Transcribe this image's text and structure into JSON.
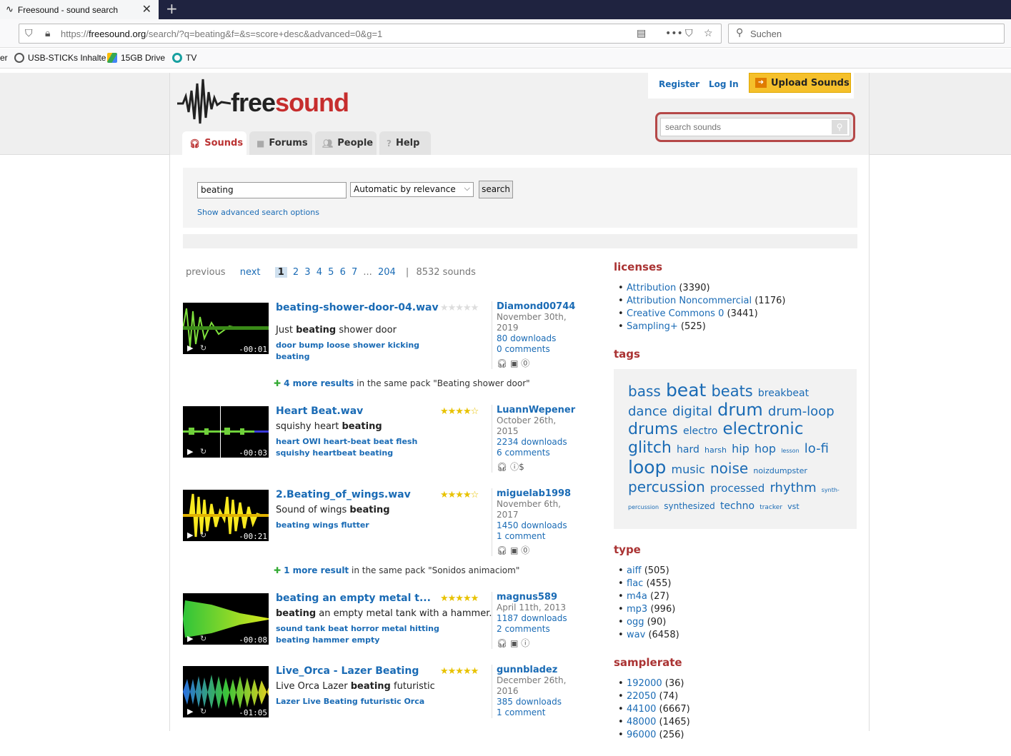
{
  "browser": {
    "tab_title": "Freesound - sound search",
    "url_prefix": "https://",
    "url_domain": "freesound.org",
    "url_rest": "/search/?q=beating&f=&s=score+desc&advanced=0&g=1",
    "search_placeholder": "Suchen",
    "bookmarks": [
      "er",
      "USB-STICKs Inhalte",
      "15GB Drive",
      "TV"
    ]
  },
  "header": {
    "logo_part1": "free",
    "logo_part2": "sound",
    "register": "Register",
    "login": "Log In",
    "upload": "Upload Sounds",
    "search_placeholder": "search sounds",
    "tabs": [
      "Sounds",
      "Forums",
      "People",
      "Help"
    ]
  },
  "search": {
    "query": "beating",
    "sort": "Automatic by relevance",
    "button": "search",
    "advanced": "Show advanced search options"
  },
  "pager": {
    "previous": "previous",
    "next": "next",
    "pages": [
      "1",
      "2",
      "3",
      "4",
      "5",
      "6",
      "7"
    ],
    "ellipsis": "...",
    "last": "204",
    "sep": "|",
    "count": "8532 sounds"
  },
  "results": [
    {
      "title": "beating-shower-door-04.wav",
      "desc_pre": "Just ",
      "desc_bold": "beating",
      "desc_post": " shower door",
      "tags": "door bump loose shower kicking beating",
      "duration": "-00:01",
      "stars": "★★★★★",
      "user": "Diamond00744",
      "date": "November 30th, 2019",
      "downloads": "80 downloads",
      "comments": "0 comments",
      "colors": [
        "#7ee03c",
        "#3a8a18"
      ]
    },
    {
      "title": "Heart Beat.wav",
      "desc_pre": "squishy heart ",
      "desc_bold": "beating",
      "desc_post": "",
      "tags": "heart OWI heart-beat beat flesh squishy heartbeat beating",
      "duration": "-00:03",
      "stars": "★★★★☆",
      "user": "LuannWepener",
      "date": "October 26th, 2015",
      "downloads": "2234 downloads",
      "comments": "6 comments",
      "colors": [
        "#6fd13a",
        "#3a3adb"
      ]
    },
    {
      "title": "2.Beating_of_wings.wav",
      "desc_pre": "Sound of wings ",
      "desc_bold": "beating",
      "desc_post": "",
      "tags": "beating wings flutter",
      "duration": "-00:21",
      "stars": "★★★★☆",
      "user": "miguelab1998",
      "date": "November 6th, 2017",
      "downloads": "1450 downloads",
      "comments": "1 comment",
      "colors": [
        "#f7e81f",
        "#e0b200"
      ]
    },
    {
      "title": "beating an empty metal t...",
      "desc_pre": "",
      "desc_bold": "beating",
      "desc_post": " an empty metal tank with a hammer.",
      "tags": "sound tank beat horror metal hitting beating hammer empty",
      "duration": "-00:08",
      "stars": "★★★★★",
      "user": "magnus589",
      "date": "April 11th, 2013",
      "downloads": "1187 downloads",
      "comments": "2 comments",
      "colors": [
        "#2fc43a",
        "#d8e81a"
      ]
    },
    {
      "title": "Live_Orca - Lazer Beating",
      "desc_pre": "Live Orca Lazer ",
      "desc_bold": "beating",
      "desc_post": " futuristic",
      "tags": "Lazer Live Beating futuristic Orca",
      "duration": "-01:05",
      "stars": "★★★★★",
      "user": "gunnbladez",
      "date": "December 26th, 2016",
      "downloads": "385 downloads",
      "comments": "1 comment",
      "colors": [
        "#2a6fe0",
        "#e0d020"
      ]
    }
  ],
  "more_results": [
    {
      "count": "4 more results",
      "text": " in the same pack \"Beating shower door\""
    },
    {
      "count": "1 more result",
      "text": " in the same pack \"Sonidos animaciom\""
    }
  ],
  "sidebar": {
    "licenses_title": "licenses",
    "licenses": [
      {
        "name": "Attribution",
        "count": "(3390)"
      },
      {
        "name": "Attribution Noncommercial",
        "count": "(1176)"
      },
      {
        "name": "Creative Commons 0",
        "count": "(3441)"
      },
      {
        "name": "Sampling+",
        "count": "(525)"
      }
    ],
    "tags_title": "tags",
    "tags": [
      {
        "t": "bass",
        "s": 20
      },
      {
        "t": "beat",
        "s": 25
      },
      {
        "t": "beats",
        "s": 21
      },
      {
        "t": "breakbeat",
        "s": 14
      },
      {
        "t": "dance",
        "s": 18
      },
      {
        "t": "digital",
        "s": 18
      },
      {
        "t": "drum",
        "s": 24
      },
      {
        "t": "drum-loop",
        "s": 18
      },
      {
        "t": "drums",
        "s": 22
      },
      {
        "t": "electro",
        "s": 14
      },
      {
        "t": "electronic",
        "s": 23
      },
      {
        "t": "glitch",
        "s": 22
      },
      {
        "t": "hard",
        "s": 14
      },
      {
        "t": "harsh",
        "s": 11
      },
      {
        "t": "hip",
        "s": 16
      },
      {
        "t": "hop",
        "s": 16
      },
      {
        "t": "lesson",
        "s": 8
      },
      {
        "t": "lo-fi",
        "s": 18
      },
      {
        "t": "loop",
        "s": 25
      },
      {
        "t": "music",
        "s": 16
      },
      {
        "t": "noise",
        "s": 20
      },
      {
        "t": "noizdumpster",
        "s": 11
      },
      {
        "t": "percussion",
        "s": 20
      },
      {
        "t": "processed",
        "s": 15
      },
      {
        "t": "rhythm",
        "s": 18
      },
      {
        "t": "synth-percussion",
        "s": 8
      },
      {
        "t": "synthesized",
        "s": 12
      },
      {
        "t": "techno",
        "s": 14
      },
      {
        "t": "tracker",
        "s": 9
      },
      {
        "t": "vst",
        "s": 11
      }
    ],
    "type_title": "type",
    "types": [
      {
        "name": "aiff",
        "count": "(505)"
      },
      {
        "name": "flac",
        "count": "(455)"
      },
      {
        "name": "m4a",
        "count": "(27)"
      },
      {
        "name": "mp3",
        "count": "(996)"
      },
      {
        "name": "ogg",
        "count": "(90)"
      },
      {
        "name": "wav",
        "count": "(6458)"
      }
    ],
    "samplerate_title": "samplerate",
    "samplerates": [
      {
        "name": "192000",
        "count": "(36)"
      },
      {
        "name": "22050",
        "count": "(74)"
      },
      {
        "name": "44100",
        "count": "(6667)"
      },
      {
        "name": "48000",
        "count": "(1465)"
      },
      {
        "name": "96000",
        "count": "(256)"
      }
    ]
  }
}
